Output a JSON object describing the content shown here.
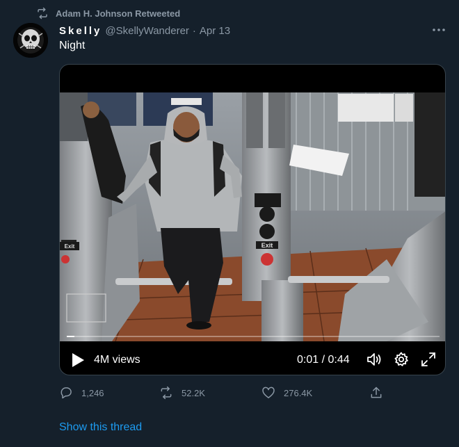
{
  "retweet": {
    "label": "Adam H. Johnson Retweeted",
    "icon": "retweet-icon"
  },
  "author": {
    "display_name": "Skelly",
    "handle": "@SkellyWanderer",
    "separator": "·",
    "date": "Apr 13"
  },
  "tweet": {
    "text": "Night"
  },
  "video": {
    "views": "4M views",
    "time": "0:01 / 0:44",
    "progress": 0.02,
    "scene_text": {
      "exit_sign": "Exit",
      "exit_label": "Exit"
    }
  },
  "actions": {
    "replies": "1,246",
    "retweets": "52.2K",
    "likes": "276.4K"
  },
  "thread_link": "Show this thread",
  "colors": {
    "background": "#15202b",
    "muted": "#8b98a5",
    "accent": "#1d9bf0",
    "border": "#38444d"
  }
}
